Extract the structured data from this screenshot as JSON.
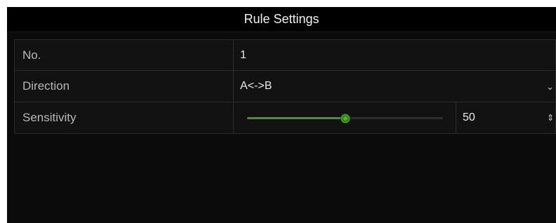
{
  "title": "Rule Settings",
  "rows": [
    {
      "label": "No.",
      "value": "1"
    },
    {
      "label": "Direction",
      "value": "A<->B",
      "icon": "chevron-down-icon"
    },
    {
      "label": "Sensitivity",
      "value": "50",
      "icon": "spin-updown-icon"
    }
  ],
  "sensitivity": {
    "level": 50,
    "min": 0,
    "max": 100
  },
  "colors": {
    "accent": "#3d9a24",
    "background": "#0b0b0b",
    "border": "#2b2b2b"
  }
}
